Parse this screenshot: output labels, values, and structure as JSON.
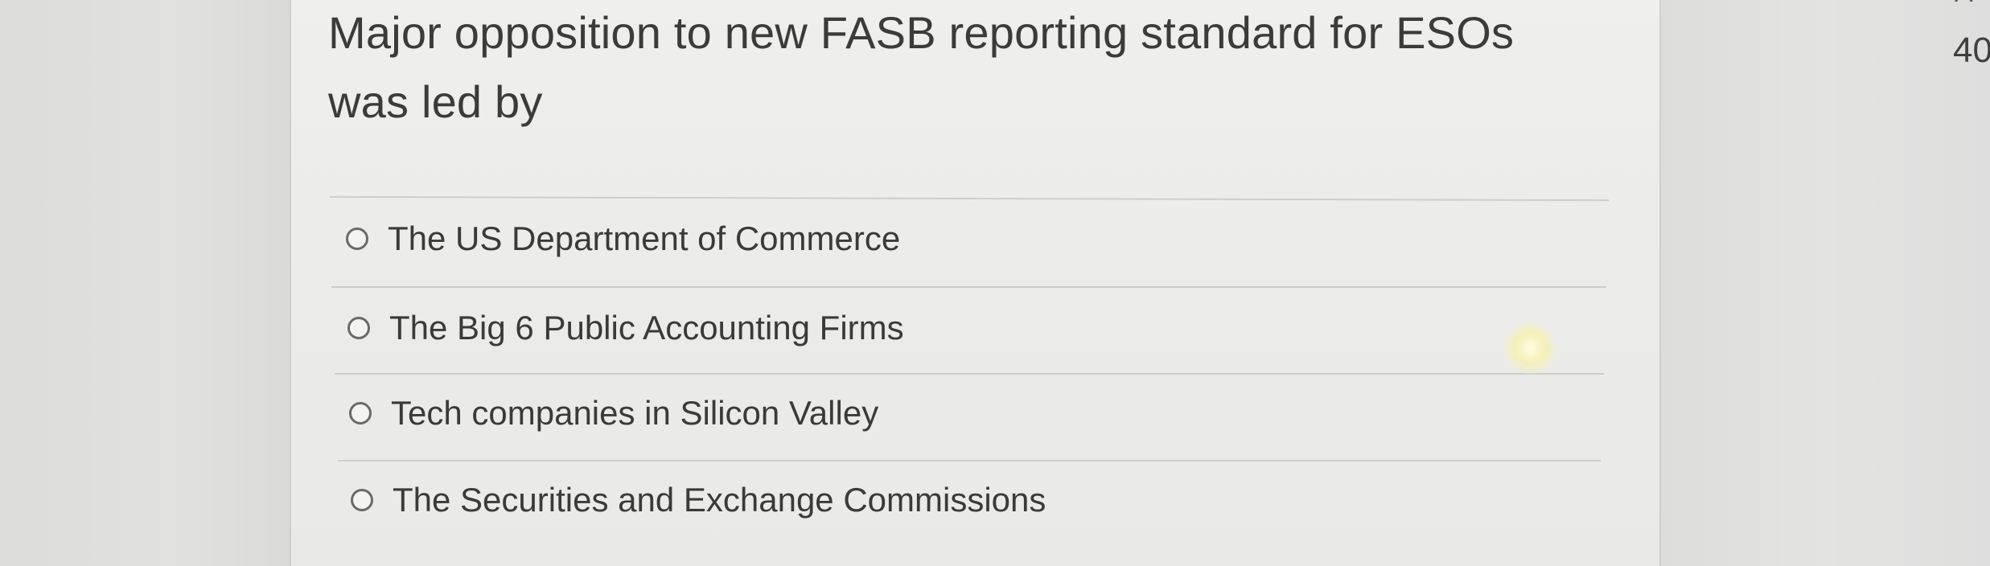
{
  "question": {
    "line1": "Major opposition to new FASB reporting standard for ESOs",
    "line2": "was led by"
  },
  "options": [
    {
      "label": "The US Department of Commerce",
      "selected": false
    },
    {
      "label": "The Big 6 Public Accounting Firms",
      "selected": false
    },
    {
      "label": "Tech companies in Silicon Valley",
      "selected": false
    },
    {
      "label": "The Securities and Exchange Commissions",
      "selected": false
    }
  ],
  "side_panel": {
    "number": "40",
    "cut_text": "A"
  },
  "colors": {
    "card_background": "#ecece9",
    "text": "#3b3b3b",
    "radio_border": "#6a6a6a"
  }
}
